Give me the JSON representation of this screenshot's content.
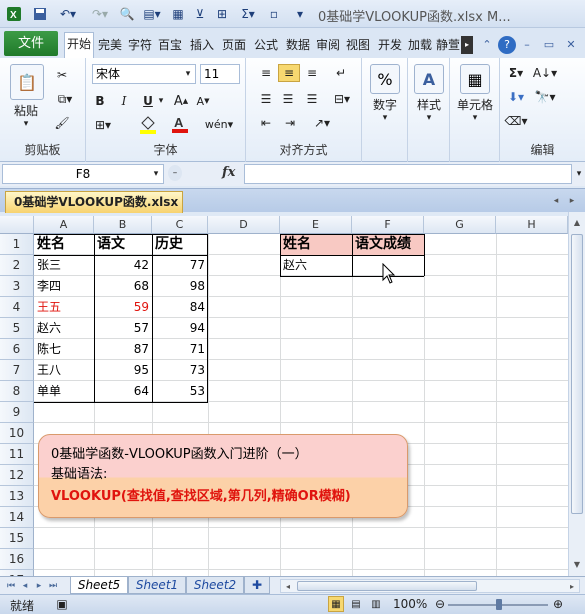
{
  "window": {
    "title": "0基础学VLOOKUP函数.xlsx M..."
  },
  "ribbon_tabs": [
    {
      "label": "文件",
      "active": false
    },
    {
      "label": "开始",
      "active": true
    },
    {
      "label": "完美"
    },
    {
      "label": "字符"
    },
    {
      "label": "百宝"
    },
    {
      "label": "插入"
    },
    {
      "label": "页面"
    },
    {
      "label": "公式"
    },
    {
      "label": "数据"
    },
    {
      "label": "审阅"
    },
    {
      "label": "视图"
    },
    {
      "label": "开发"
    },
    {
      "label": "加载"
    },
    {
      "label": "静萱"
    }
  ],
  "ribbon": {
    "clipboard": {
      "paste_label": "粘贴",
      "group_label": "剪贴板"
    },
    "font": {
      "name": "宋体",
      "size": "11",
      "group_label": "字体",
      "bold": "B",
      "italic": "I",
      "underline": "U"
    },
    "alignment": {
      "group_label": "对齐方式"
    },
    "number": {
      "label": "数字",
      "percent": "%"
    },
    "styles": {
      "label": "样式"
    },
    "cells": {
      "label": "单元格"
    },
    "editing": {
      "group_label": "编辑",
      "sigma": "Σ"
    }
  },
  "formula_bar": {
    "name_box": "F8",
    "fx": "fx",
    "value": ""
  },
  "workbook_tab": "0基础学VLOOKUP函数.xlsx",
  "columns": [
    "A",
    "B",
    "C",
    "D",
    "E",
    "F",
    "G",
    "H"
  ],
  "rows": [
    "1",
    "2",
    "3",
    "4",
    "5",
    "6",
    "7",
    "8",
    "9",
    "10",
    "11",
    "12",
    "13",
    "14",
    "15",
    "16",
    "17"
  ],
  "table": {
    "headers": [
      "姓名",
      "语文",
      "历史"
    ],
    "rows": [
      {
        "name": "张三",
        "chinese": "42",
        "history": "77"
      },
      {
        "name": "李四",
        "chinese": "68",
        "history": "98"
      },
      {
        "name": "王五",
        "chinese": "59",
        "history": "84"
      },
      {
        "name": "赵六",
        "chinese": "57",
        "history": "94"
      },
      {
        "name": "陈七",
        "chinese": "87",
        "history": "71"
      },
      {
        "name": "王八",
        "chinese": "95",
        "history": "73"
      },
      {
        "name": "单单",
        "chinese": "64",
        "history": "53"
      }
    ]
  },
  "lookup": {
    "header_name": "姓名",
    "header_score": "语文成绩",
    "name": "赵六",
    "score": ""
  },
  "callout": {
    "line1": "0基础学函数-VLOOKUP函数入门进阶（一）",
    "line2": "基础语法:",
    "line3": "VLOOKUP(查找值,查找区域,第几列,精确OR模糊)"
  },
  "colors": {
    "red_text": "#e0140e",
    "lookup_header_bg": "#f8c9c3"
  },
  "sheets": [
    {
      "label": "Sheet5",
      "active": true
    },
    {
      "label": "Sheet1",
      "active": false
    },
    {
      "label": "Sheet2",
      "active": false
    }
  ],
  "status": {
    "mode": "就绪",
    "zoom": "100%"
  }
}
